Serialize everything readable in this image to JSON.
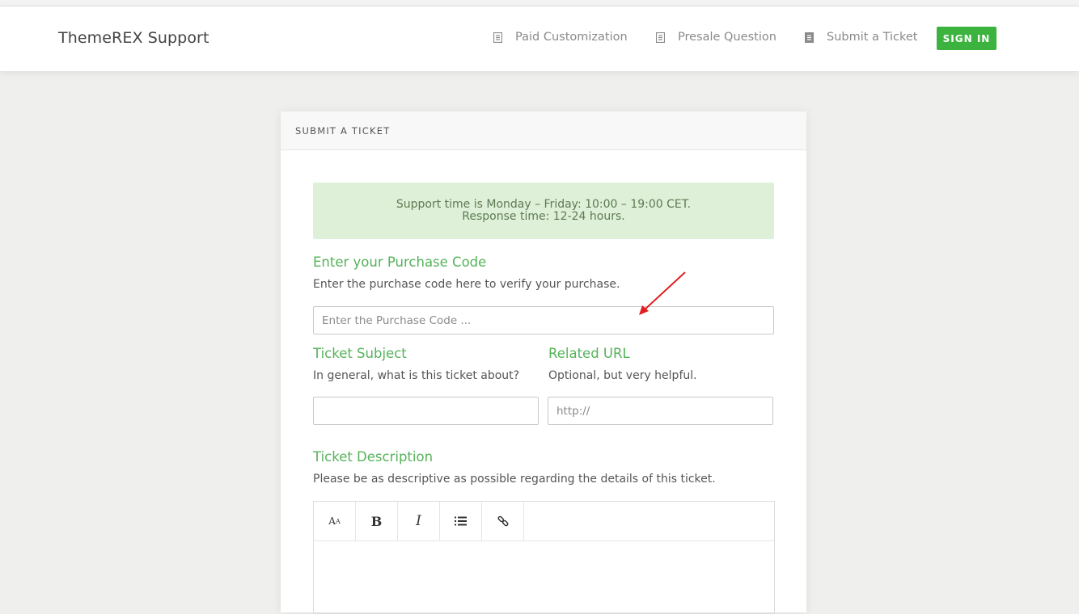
{
  "header": {
    "brand": "ThemeREX Support",
    "nav": [
      {
        "label": "Paid Customization",
        "icon": "document-icon"
      },
      {
        "label": "Presale Question",
        "icon": "document-icon"
      },
      {
        "label": "Submit a Ticket",
        "icon": "document-icon"
      }
    ],
    "signin_label": "SIGN IN"
  },
  "card": {
    "title": "SUBMIT A TICKET",
    "notice_line1": "Support time is Monday – Friday: 10:00 – 19:00 CET.",
    "notice_line2": "Response time: 12-24 hours.",
    "purchase": {
      "label": "Enter your Purchase Code",
      "desc": "Enter the purchase code here to verify your purchase.",
      "placeholder": "Enter the Purchase Code ...",
      "value": ""
    },
    "subject": {
      "label": "Ticket Subject",
      "desc": "In general, what is this ticket about?",
      "value": ""
    },
    "url": {
      "label": "Related URL",
      "desc": "Optional, but very helpful.",
      "placeholder": "http://",
      "value": ""
    },
    "description": {
      "label": "Ticket Description",
      "desc": "Please be as descriptive as possible regarding the details of this ticket.",
      "toolbar": [
        "font-size-icon",
        "bold-icon",
        "italic-icon",
        "list-icon",
        "link-icon"
      ]
    }
  },
  "colors": {
    "accent": "#3db33f",
    "label_green": "#55b35a",
    "notice_bg": "#dff0d8",
    "annotation_arrow": "#e02020"
  }
}
